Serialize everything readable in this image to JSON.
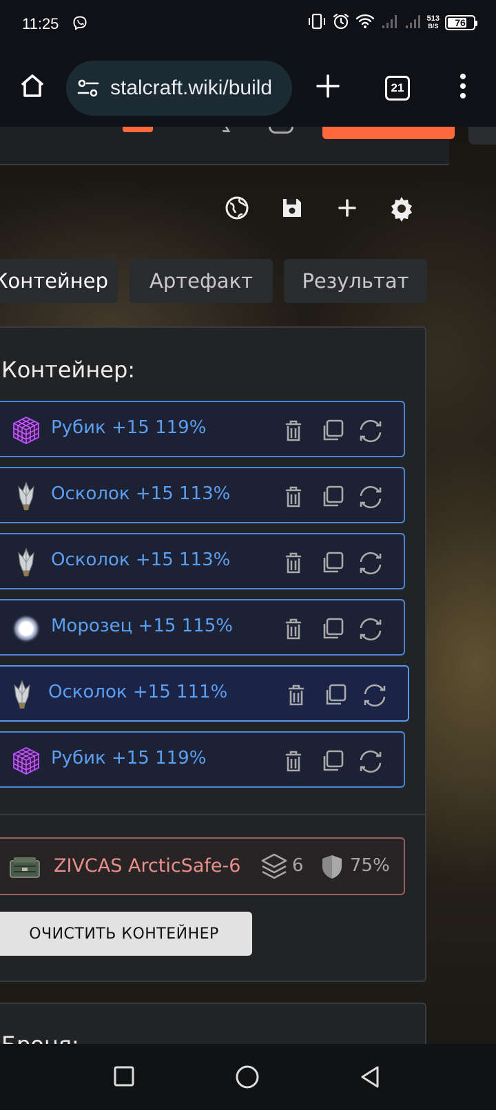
{
  "status": {
    "time": "11:25",
    "net_speed_value": "513",
    "net_speed_unit": "B/S",
    "battery": "76",
    "battery_level": 0.76
  },
  "browser": {
    "url": "stalcraft.wiki/build",
    "tab_count": "21"
  },
  "tabs": [
    "Контейнер",
    "Артефакт",
    "Результат"
  ],
  "panel": {
    "title": "Контейнер:",
    "artifacts": [
      {
        "label": "Рубик +15 119%",
        "icon": "rubik-cube-icon"
      },
      {
        "label": "Осколок +15 113%",
        "icon": "crystal-shard-icon"
      },
      {
        "label": "Осколок +15 113%",
        "icon": "crystal-shard-icon"
      },
      {
        "label": "Морозец +15 115%",
        "icon": "frost-orb-icon"
      },
      {
        "label": "Осколок +15 111%",
        "icon": "crystal-shard-icon",
        "selected": true
      },
      {
        "label": "Рубик +15 119%",
        "icon": "rubik-cube-icon"
      }
    ],
    "container": {
      "name": "ZIVCAS ArcticSafe-6",
      "slots": "6",
      "protection": "75%"
    },
    "clear_button": "ОЧИСТИТЬ КОНТЕЙНЕР"
  },
  "panel2": {
    "title": "Броня:"
  },
  "colors": {
    "accent_blue": "#5c9ef0",
    "accent_orange": "#ff6a3d",
    "container_red": "#e98f8a"
  }
}
